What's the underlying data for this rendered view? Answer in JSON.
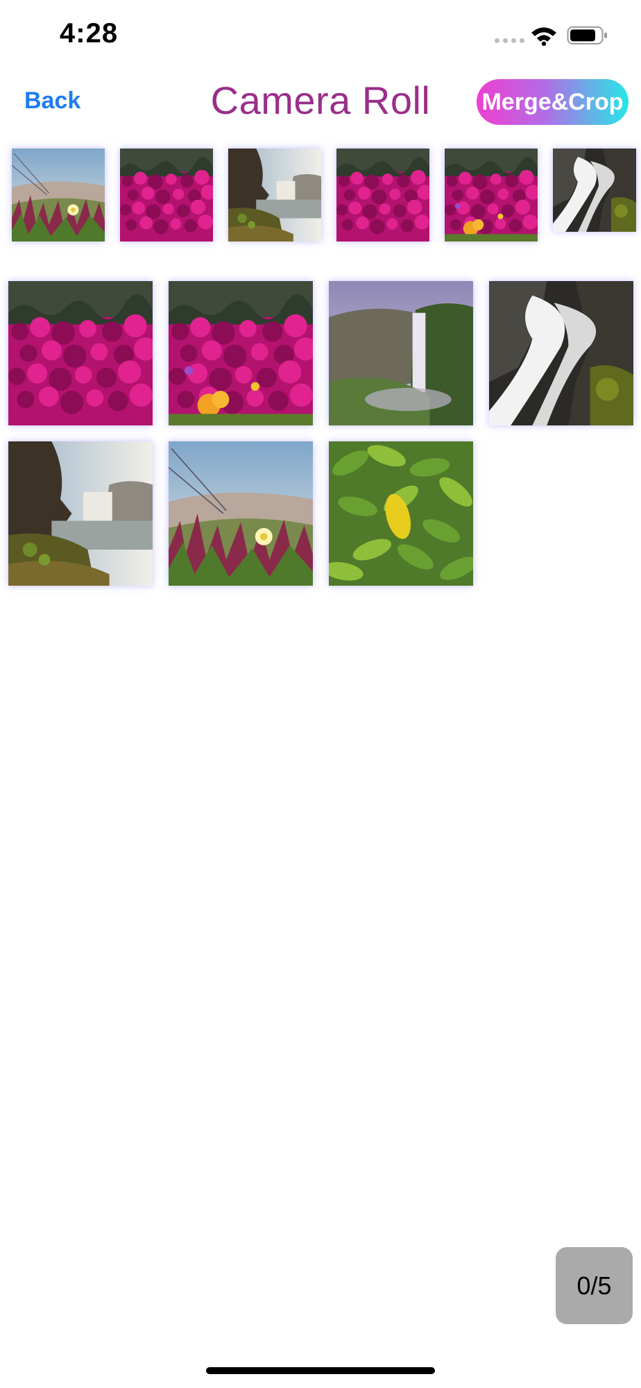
{
  "status": {
    "time": "4:28"
  },
  "nav": {
    "back_label": "Back",
    "title": "Camera Roll",
    "merge_label": "Merge&Crop"
  },
  "strip": [
    {
      "kind": "dune-flower"
    },
    {
      "kind": "pink-flowers"
    },
    {
      "kind": "cliff-waterfall"
    },
    {
      "kind": "pink-flowers"
    },
    {
      "kind": "pink-flowers-orange"
    },
    {
      "kind": "rock-waterfall"
    }
  ],
  "grid": [
    {
      "kind": "pink-flowers"
    },
    {
      "kind": "pink-flowers-orange"
    },
    {
      "kind": "valley-waterfall"
    },
    {
      "kind": "rock-waterfall"
    },
    {
      "kind": "cliff-waterfall"
    },
    {
      "kind": "dune-flower"
    },
    {
      "kind": "green-leaves"
    }
  ],
  "selection": {
    "counter": "0/5"
  },
  "colors": {
    "accent_blue": "#1f7cf0",
    "title_purple": "#9a2e8a"
  }
}
